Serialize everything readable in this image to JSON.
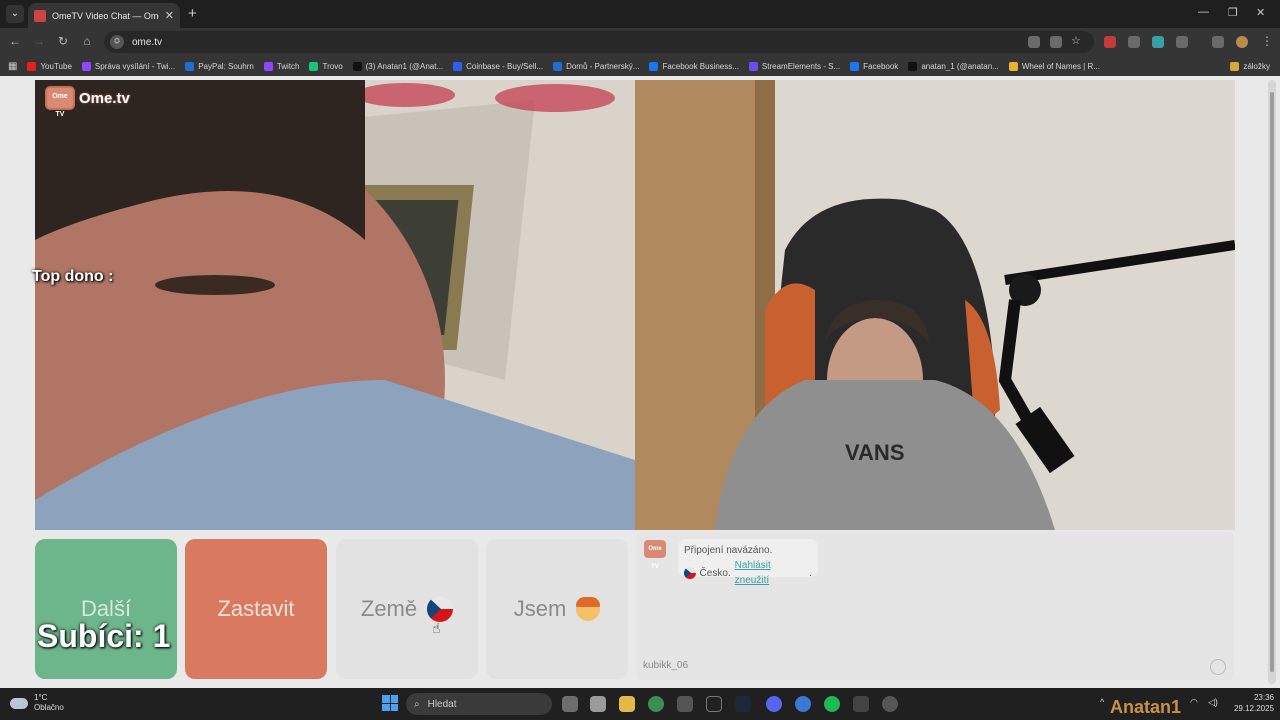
{
  "browser": {
    "tab_title": "OmeTV Video Chat — Ome",
    "url": "ome.tv",
    "bookmarks": [
      {
        "label": "YouTube",
        "color": "#e62117"
      },
      {
        "label": "Správa vysílání - Twi...",
        "color": "#9146ff"
      },
      {
        "label": "PayPal: Souhrn",
        "color": "#1f6fd1"
      },
      {
        "label": "Twitch",
        "color": "#9146ff"
      },
      {
        "label": "Trovo",
        "color": "#18c479"
      },
      {
        "label": "(3) Anatan1 (@Anat...",
        "color": "#111111"
      },
      {
        "label": "Coinbase - Buy/Sell...",
        "color": "#2f5ef5"
      },
      {
        "label": "Domů - Partnerský...",
        "color": "#1f6fd1"
      },
      {
        "label": "Facebook Business...",
        "color": "#1877f2"
      },
      {
        "label": "StreamElements - S...",
        "color": "#6c4cf5"
      },
      {
        "label": "Facebook",
        "color": "#1877f2"
      },
      {
        "label": "anatan_1 (@anatan...",
        "color": "#111111"
      },
      {
        "label": "Wheel of Names | R...",
        "color": "#e9b32a"
      },
      {
        "label": "záložky",
        "color": "#d8a83a"
      }
    ]
  },
  "video": {
    "logo_badge": "Ome TV",
    "logo_text": "Ome.tv",
    "overlay_top_dono": "Top dono :"
  },
  "controls": {
    "next_label": "Další",
    "stop_label": "Zastavit",
    "country_label": "Země",
    "gender_label": "Jsem",
    "subs_overlay": "Subíci: 1"
  },
  "chat": {
    "logo_badge": "Ome TV",
    "status_text": "Připojení navázáno.",
    "country_text": "Česko.",
    "report_link": "Nahlásit zneužití",
    "report_suffix": ".",
    "input_value": "kubikk_06"
  },
  "taskbar": {
    "weather_temp": "1°C",
    "weather_desc": "Oblačno",
    "search_placeholder": "Hledat",
    "time": "23:36",
    "date": "29.12.2025",
    "watermark": "Anatan1"
  }
}
